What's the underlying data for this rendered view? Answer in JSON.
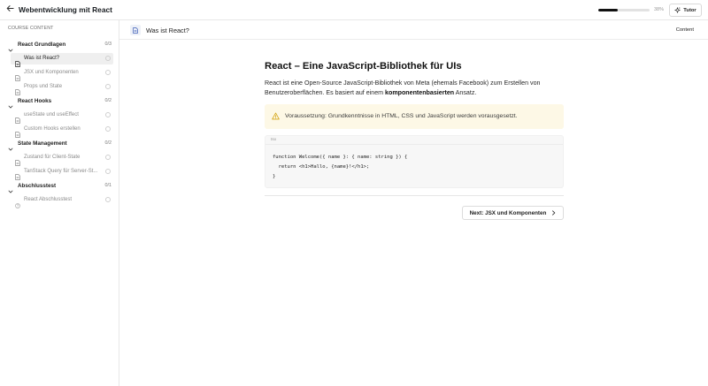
{
  "header": {
    "course_title": "Webentwicklung mit React",
    "progress_percent": 38,
    "progress_label": "38%",
    "tutor_label": "Tutor"
  },
  "sidebar": {
    "heading": "COURSE CONTENT",
    "sections": [
      {
        "title": "React Grundlagen",
        "count": "0/3",
        "lessons": [
          {
            "title": "Was ist React?",
            "active": true,
            "icon": "document-icon"
          },
          {
            "title": "JSX und Komponenten",
            "active": false,
            "icon": "document-icon"
          },
          {
            "title": "Props und State",
            "active": false,
            "icon": "document-icon"
          }
        ]
      },
      {
        "title": "React Hooks",
        "count": "0/2",
        "lessons": [
          {
            "title": "useState und useEffect",
            "active": false,
            "icon": "document-icon"
          },
          {
            "title": "Custom Hooks erstellen",
            "active": false,
            "icon": "document-icon"
          }
        ]
      },
      {
        "title": "State Management",
        "count": "0/2",
        "lessons": [
          {
            "title": "Zustand für Client-State",
            "active": false,
            "icon": "document-icon"
          },
          {
            "title": "TanStack Query für Server-St...",
            "active": false,
            "icon": "document-icon"
          }
        ]
      },
      {
        "title": "Abschlusstest",
        "count": "0/1",
        "lessons": [
          {
            "title": "React Abschlusstest",
            "active": false,
            "icon": "quiz-icon"
          }
        ]
      }
    ]
  },
  "subheader": {
    "lesson_title": "Was ist React?",
    "content_label": "Content"
  },
  "article": {
    "title": "React – Eine JavaScript-Bibliothek für UIs",
    "para_before": "React ist eine Open-Source JavaScript-Bibliothek von Meta (ehemals Facebook) zum Erstellen von Benutzeroberflächen. Es basiert auf einem ",
    "para_bold": "komponentenbasierten",
    "para_after": " Ansatz.",
    "callout": "Voraussetzung: Grundkenntnisse in HTML, CSS und JavaScript werden vorausgesetzt.",
    "code_lang": "tsx",
    "code": "function Welcome({ name }: { name: string }) {\n  return <h1>Hallo, {name}!</h1>;\n}",
    "next_label": "Next: JSX und Komponenten"
  },
  "colors": {
    "callout_bg": "#fdf8e6",
    "warning_icon": "#d4a514",
    "active_lesson_bg": "#efefef"
  }
}
